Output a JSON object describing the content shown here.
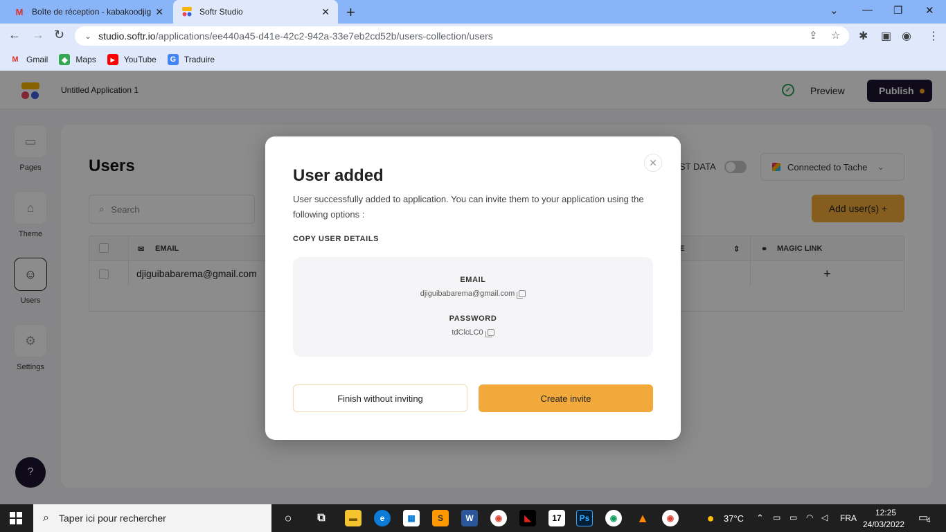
{
  "browser": {
    "tabs": [
      {
        "title": "Boîte de réception - kabakoodjig",
        "favicon": "gmail-icon",
        "active": false
      },
      {
        "title": "Softr Studio",
        "favicon": "softr-icon",
        "active": true
      }
    ],
    "url_host": "studio.softr.io",
    "url_path": "/applications/ee440a45-d41e-42c2-942a-33e7eb2cd52b/users-collection/users",
    "bookmarks": [
      {
        "label": "Gmail",
        "icon": "gmail-icon"
      },
      {
        "label": "Maps",
        "icon": "maps-icon"
      },
      {
        "label": "YouTube",
        "icon": "youtube-icon"
      },
      {
        "label": "Traduire",
        "icon": "translate-icon"
      }
    ]
  },
  "app": {
    "title": "Untitled Application 1",
    "preview_label": "Preview",
    "publish_label": "Publish",
    "sidebar": [
      {
        "label": "Pages",
        "icon": "pages-icon"
      },
      {
        "label": "Theme",
        "icon": "theme-icon"
      },
      {
        "label": "Users",
        "icon": "users-icon",
        "active": true
      },
      {
        "label": "Settings",
        "icon": "settings-icon"
      }
    ],
    "users_title": "Users",
    "search_placeholder": "Search",
    "testdata_label": "ST DATA",
    "connected_label": "Connected to Tache",
    "add_user_label": "Add user(s)  +",
    "table": {
      "columns": [
        "EMAIL",
        "E",
        "MAGIC LINK"
      ],
      "rows": [
        {
          "email": "djiguibabarema@gmail.com"
        }
      ]
    }
  },
  "modal": {
    "title": "User added",
    "description": "User successfully added to application. You can invite them to your application using the following options :",
    "subheading": "COPY USER DETAILS",
    "email_label": "EMAIL",
    "email_value": "djiguibabarema@gmail.com",
    "password_label": "PASSWORD",
    "password_value": "tdClcLC0",
    "finish_label": "Finish without inviting",
    "invite_label": "Create invite"
  },
  "taskbar": {
    "search_placeholder": "Taper ici pour rechercher",
    "weather": "37°C",
    "language": "FRA",
    "time": "12:25",
    "date": "24/03/2022",
    "notifications": "4"
  },
  "colors": {
    "accent": "#f0a93a",
    "publish_bg": "#1d1530",
    "tabbar": "#8ab4f8"
  }
}
